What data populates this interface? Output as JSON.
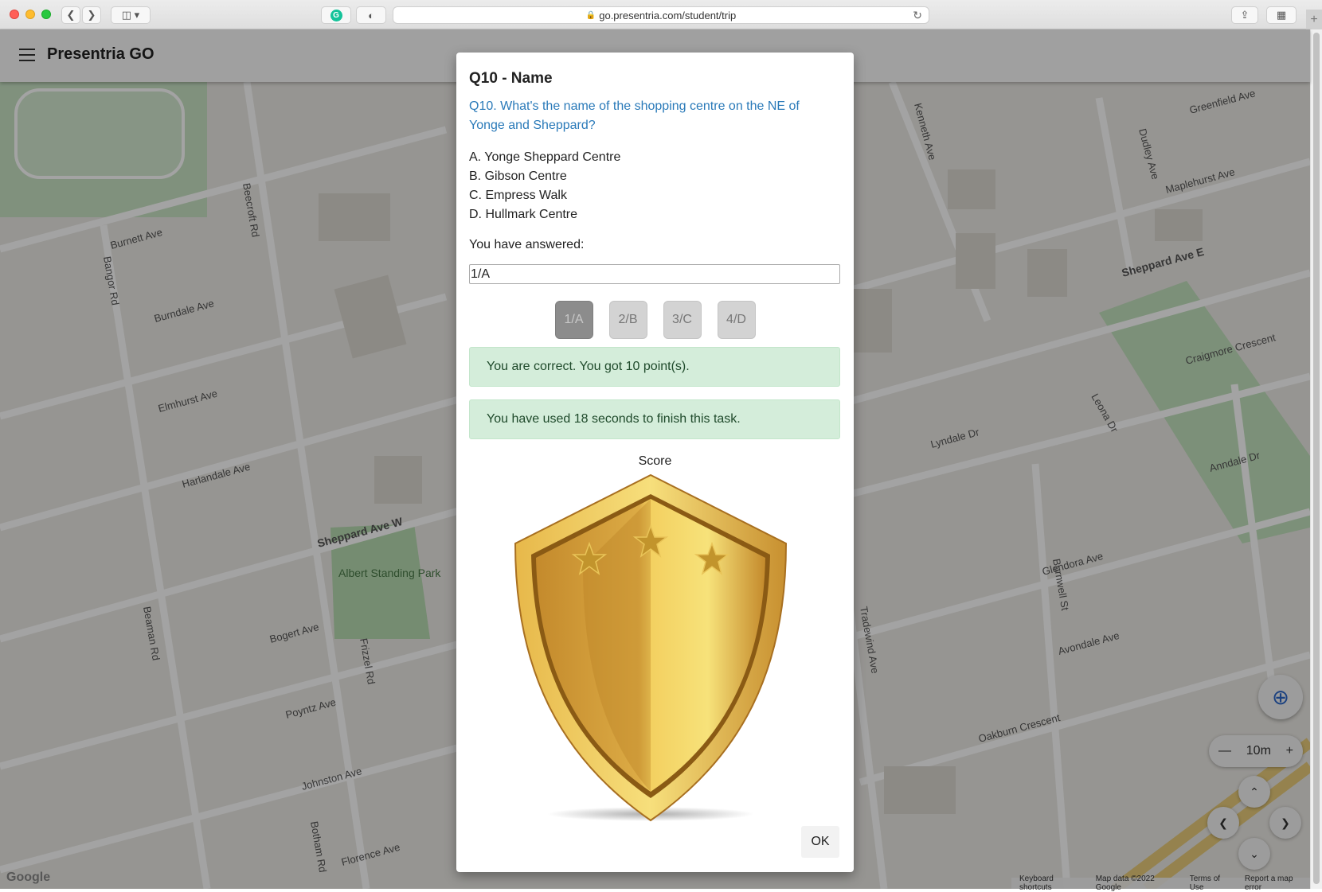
{
  "browser": {
    "url": "go.presentria.com/student/trip",
    "icons": [
      "back-icon",
      "forward-icon",
      "sidebar-icon",
      "grammarly-icon",
      "privacy-icon",
      "lock-icon",
      "reload-icon",
      "share-icon",
      "tabs-overview-icon",
      "new-tab-icon"
    ]
  },
  "app": {
    "title": "Presentria GO"
  },
  "map": {
    "street_labels": [
      "Beecroft Rd",
      "Burnett Ave",
      "Burndale Ave",
      "Bangor Rd",
      "Elmhurst Ave",
      "Harlandale Ave",
      "Sheppard Ave W",
      "Albert Standing Park",
      "Bogert Ave",
      "Frizzel Rd",
      "Beaman Rd",
      "Poyntz Ave",
      "Johnston Ave",
      "Botham Rd",
      "Florence Ave",
      "Sheppard Ave E",
      "Kenneth Ave",
      "Dudley Ave",
      "Greenfield Ave",
      "Maplehurst Ave",
      "Craigmore Crescent",
      "Lyndale Dr",
      "Anndale Dr",
      "Leona Dr",
      "Glendora Ave",
      "Avondale Ave",
      "Oakburn Crescent",
      "Burnwell St",
      "Tradewind Ave"
    ],
    "zoom_label": "10m",
    "footer": {
      "shortcuts": "Keyboard shortcuts",
      "map_data": "Map data ©2022 Google",
      "terms": "Terms of Use",
      "report": "Report a map error"
    },
    "logo": "Google"
  },
  "modal": {
    "title": "Q10 - Name",
    "question": "Q10. What's the name of the shopping centre on the NE of Yonge and Sheppard?",
    "options": [
      "A. Yonge Sheppard Centre",
      "B. Gibson Centre",
      "C. Empress Walk",
      "D. Hullmark Centre"
    ],
    "answered_label": "You have answered:",
    "answer_value": "1/A",
    "choices": [
      "1/A",
      "2/B",
      "3/C",
      "4/D"
    ],
    "selected_choice": "1/A",
    "correct_message": "You are correct. You got 10 point(s).",
    "time_message": "You have used 18 seconds to finish this task.",
    "score_label": "Score",
    "stars": 3,
    "ok_label": "OK"
  },
  "colors": {
    "question_text": "#2a7ab9",
    "success_bg": "#d4edda",
    "shield_gold": "#d9a83a",
    "locate_blue": "#2b66c9"
  }
}
